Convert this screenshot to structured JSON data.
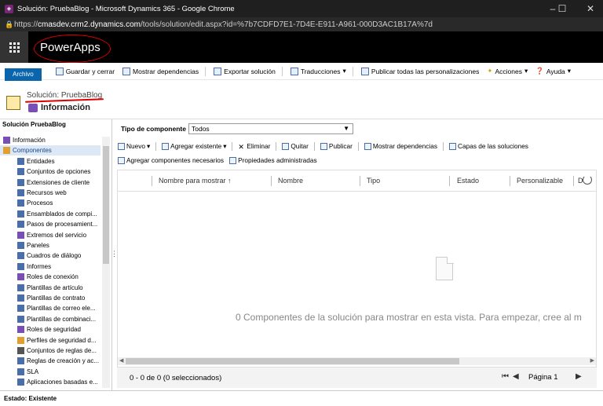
{
  "window": {
    "title": "Solución: PruebaBlog - Microsoft Dynamics 365 - Google Chrome",
    "url_host": "cmasdev.crm2.dynamics.com",
    "url_prefix": "https://",
    "url_path": "/tools/solution/edit.aspx?id=%7b7CDFD7E1-7D4E-E911-A961-000D3AC1B17A%7d"
  },
  "app": {
    "brand": "PowerApps",
    "brand_color": "#000000",
    "accent": "#0a65ad"
  },
  "ribbon": {
    "file_tab": "Archivo",
    "save_close": "Guardar y cerrar",
    "show_deps": "Mostrar dependencias",
    "export": "Exportar solución",
    "translations": "Traducciones",
    "publish_all": "Publicar todas las personalizaciones",
    "actions": "Acciones",
    "help": "Ayuda"
  },
  "header": {
    "solution": "Solución: PruebaBlog",
    "section": "Información"
  },
  "sidebar": {
    "title": "Solución PruebaBlog",
    "items": [
      {
        "label": "Información",
        "icon": "info-icon",
        "color": "#7a4fb5"
      },
      {
        "label": "Componentes",
        "icon": "components-icon",
        "color": "#e0a030"
      },
      {
        "label": "Entidades",
        "icon": "entity-icon",
        "color": "#4a6ea9"
      },
      {
        "label": "Conjuntos de opciones",
        "icon": "optionset-icon",
        "color": "#4a6ea9"
      },
      {
        "label": "Extensiones de cliente",
        "icon": "extension-icon",
        "color": "#4a6ea9"
      },
      {
        "label": "Recursos web",
        "icon": "webresource-icon",
        "color": "#4a6ea9"
      },
      {
        "label": "Procesos",
        "icon": "process-icon",
        "color": "#4a6ea9"
      },
      {
        "label": "Ensamblados de compi...",
        "icon": "assembly-icon",
        "color": "#4a6ea9"
      },
      {
        "label": "Pasos de procesamient...",
        "icon": "step-icon",
        "color": "#4a6ea9"
      },
      {
        "label": "Extremos del servicio",
        "icon": "endpoint-icon",
        "color": "#7a4fb5"
      },
      {
        "label": "Paneles",
        "icon": "dashboard-icon",
        "color": "#4a6ea9"
      },
      {
        "label": "Cuadros de diálogo",
        "icon": "dialog-icon",
        "color": "#4a6ea9"
      },
      {
        "label": "Informes",
        "icon": "report-icon",
        "color": "#4a6ea9"
      },
      {
        "label": "Roles de conexión",
        "icon": "connection-icon",
        "color": "#7a4fb5"
      },
      {
        "label": "Plantillas de artículo",
        "icon": "article-template-icon",
        "color": "#4a6ea9"
      },
      {
        "label": "Plantillas de contrato",
        "icon": "contract-template-icon",
        "color": "#4a6ea9"
      },
      {
        "label": "Plantillas de correo ele...",
        "icon": "email-template-icon",
        "color": "#4a6ea9"
      },
      {
        "label": "Plantillas de combinaci...",
        "icon": "mailmerge-template-icon",
        "color": "#4a6ea9"
      },
      {
        "label": "Roles de seguridad",
        "icon": "security-role-icon",
        "color": "#7a4fb5"
      },
      {
        "label": "Perfiles de seguridad d...",
        "icon": "security-profile-icon",
        "color": "#e0a030"
      },
      {
        "label": "Conjuntos de reglas de...",
        "icon": "ruleset-icon",
        "color": "#555555"
      },
      {
        "label": "Reglas de creación y ac...",
        "icon": "rule-icon",
        "color": "#4a6ea9"
      },
      {
        "label": "SLA",
        "icon": "sla-icon",
        "color": "#4a6ea9"
      },
      {
        "label": "Aplicaciones basadas e...",
        "icon": "app-icon",
        "color": "#4a6ea9"
      }
    ]
  },
  "main": {
    "component_type_label": "Tipo de componente",
    "component_type_value": "Todos",
    "toolbar1": [
      {
        "label": "Nuevo",
        "icon": "new-icon",
        "dropdown": true
      },
      {
        "label": "Agregar existente",
        "icon": "add-existing-icon",
        "dropdown": true
      },
      {
        "label": "Eliminar",
        "icon": "delete-icon"
      },
      {
        "label": "Quitar",
        "icon": "remove-icon"
      },
      {
        "label": "Publicar",
        "icon": "publish-icon"
      },
      {
        "label": "Mostrar dependencias",
        "icon": "dependencies-icon"
      },
      {
        "label": "Capas de las soluciones",
        "icon": "layers-icon"
      }
    ],
    "toolbar2": [
      {
        "label": "Agregar componentes necesarios",
        "icon": "add-required-icon"
      },
      {
        "label": "Propiedades administradas",
        "icon": "managed-properties-icon"
      }
    ],
    "columns": [
      "Nombre para mostrar ↑",
      "Nombre",
      "Tipo",
      "Estado",
      "Personalizable",
      "D"
    ],
    "empty_message": "0 Componentes de la solución para mostrar en esta vista. Para empezar, cree al m",
    "count": "0 - 0  de 0 (0 seleccionados)",
    "page": "Página 1"
  },
  "status": "Estado: Existente"
}
